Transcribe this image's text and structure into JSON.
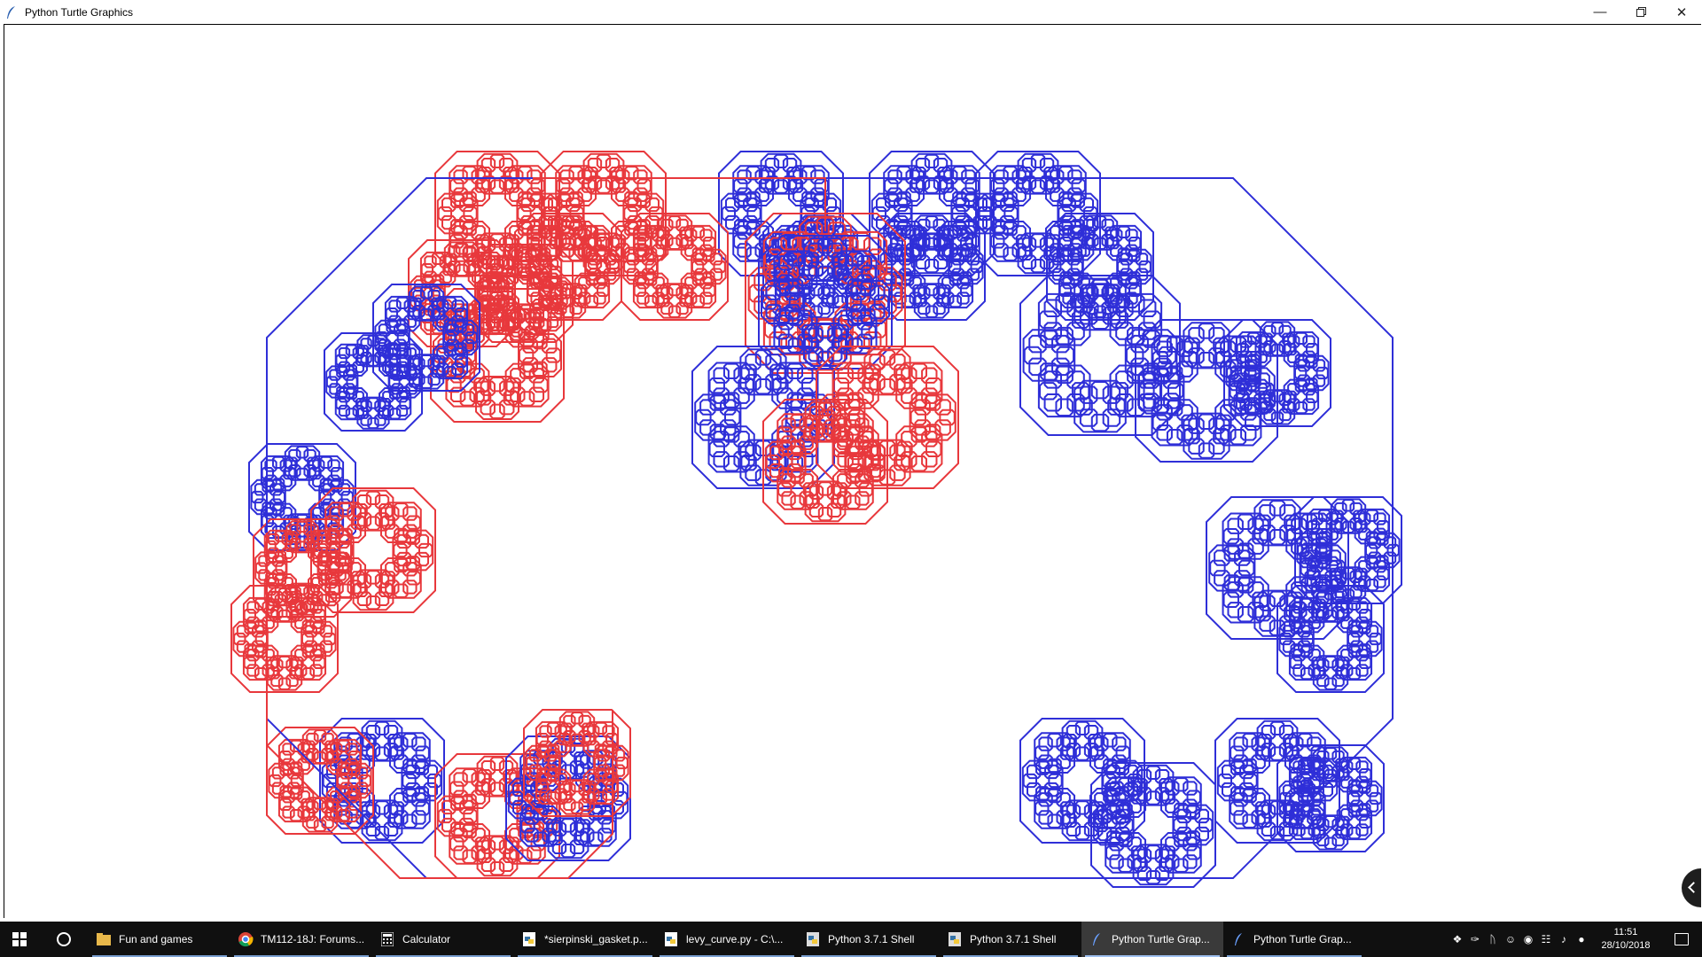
{
  "window": {
    "title": "Python Turtle Graphics",
    "icon": "feather-icon",
    "controls": {
      "minimize": "minimize-icon",
      "maximize": "restore-icon",
      "close": "close-icon"
    }
  },
  "canvas": {
    "background": "#ffffff",
    "colors": {
      "red": "#e8383c",
      "blue": "#2f2fd8"
    }
  },
  "taskbar": {
    "background": "#101010",
    "start_icon": "windows-start-icon",
    "search_icon": "cortana-ring-icon",
    "tasks": [
      {
        "label": "Fun and games",
        "icon": "folder-icon"
      },
      {
        "label": "TM112-18J: Forums...",
        "icon": "chrome-icon"
      },
      {
        "label": "Calculator",
        "icon": "calculator-icon"
      },
      {
        "label": "*sierpinski_gasket.p...",
        "icon": "python-file-icon"
      },
      {
        "label": "levy_curve.py - C:\\...",
        "icon": "python-file-icon"
      },
      {
        "label": "Python 3.7.1 Shell",
        "icon": "python-icon"
      },
      {
        "label": "Python 3.7.1 Shell",
        "icon": "python-icon"
      },
      {
        "label": "Python Turtle Grap...",
        "icon": "feather-icon"
      },
      {
        "label": "Python Turtle Grap...",
        "icon": "feather-icon"
      }
    ],
    "clock": {
      "time": "11:51",
      "date": "28/10/2018"
    }
  }
}
